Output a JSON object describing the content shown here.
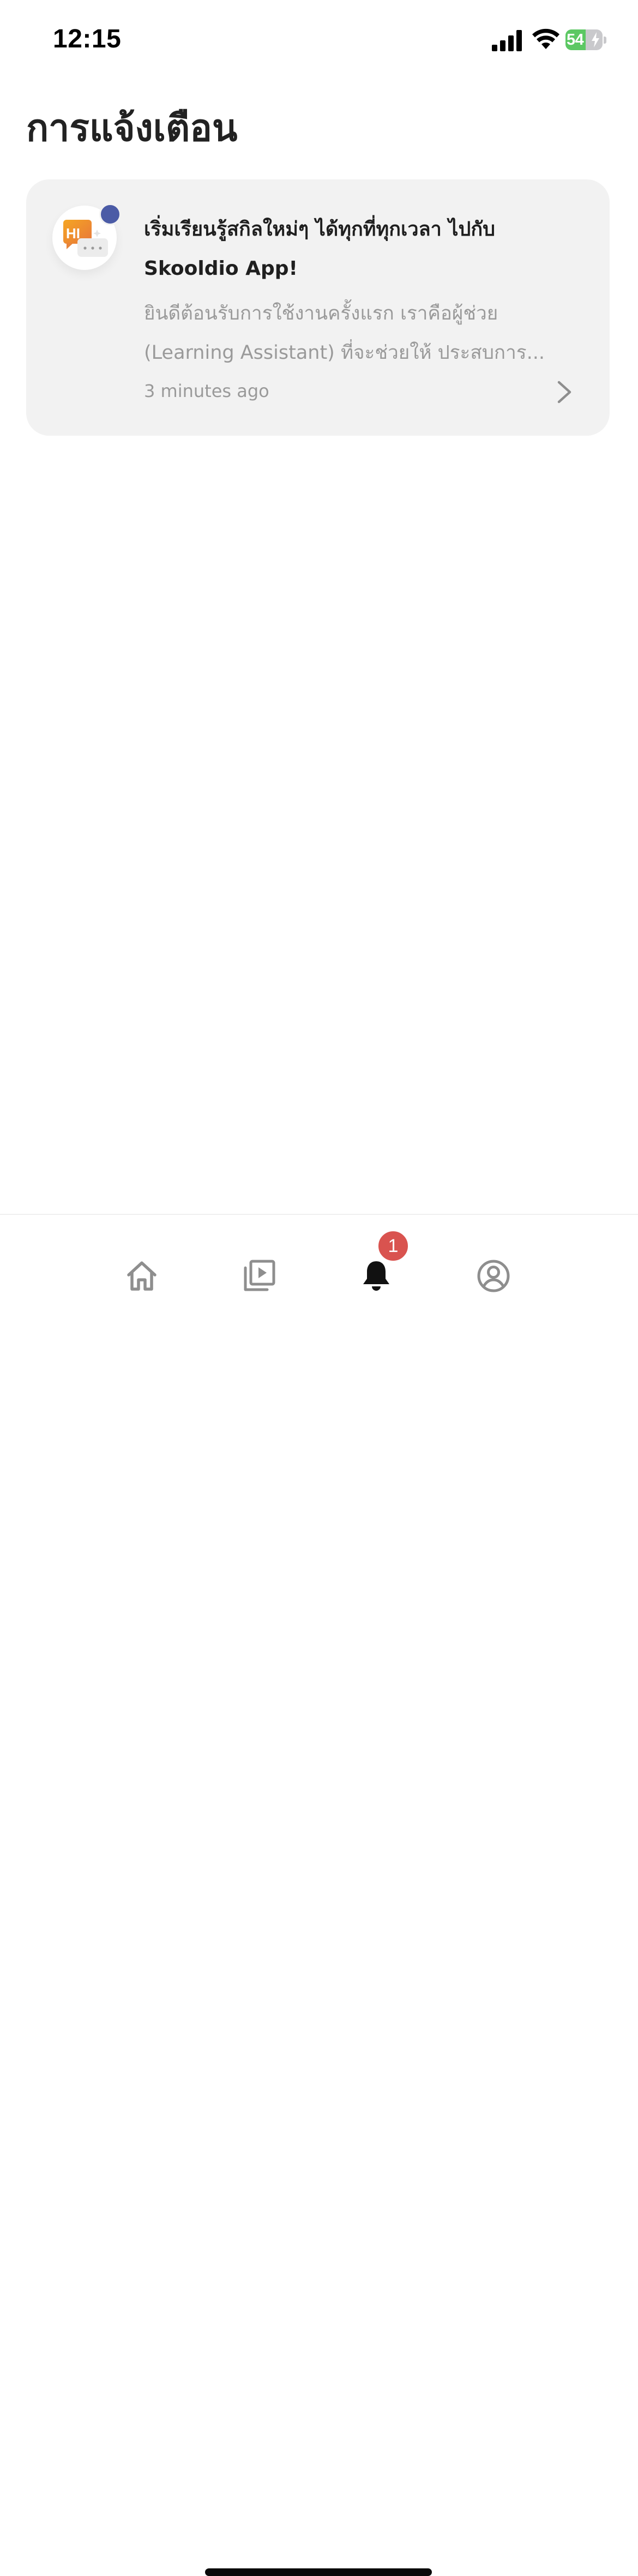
{
  "status_bar": {
    "time": "12:15",
    "battery_percent": "54",
    "battery_level": 0.54,
    "battery_charging": true,
    "signal_icon": "cellular-signal-icon",
    "wifi_icon": "wifi-icon"
  },
  "page": {
    "title": "การแจ้งเตือน"
  },
  "notifications": [
    {
      "title": "เริ่มเรียนรู้สกิลใหม่ๆ ได้ทุกที่ทุกเวลา ไปกับ Skooldio App!",
      "body": "ยินดีต้อนรับการใช้งานครั้งแรก เราคือผู้ช่วย (Learning Assistant) ที่จะช่วยให้ ประสบการ...",
      "time": "3 minutes ago",
      "unread": true,
      "avatar_icon": "hi-chat-bubble-icon",
      "avatar_text": "HI"
    }
  ],
  "tab_bar": {
    "tabs": [
      {
        "name": "home",
        "icon": "home-icon",
        "active": false
      },
      {
        "name": "videos",
        "icon": "video-library-icon",
        "active": false
      },
      {
        "name": "notifications",
        "icon": "bell-icon",
        "active": true,
        "badge": "1"
      },
      {
        "name": "profile",
        "icon": "profile-icon",
        "active": false
      }
    ]
  },
  "colors": {
    "unread_dot": "#4b5ba6",
    "badge": "#d9534f",
    "battery_fill": "#5cc863",
    "card_bg": "#f2f2f2",
    "inactive_icon": "#8e8e8e",
    "active_icon": "#111111"
  }
}
